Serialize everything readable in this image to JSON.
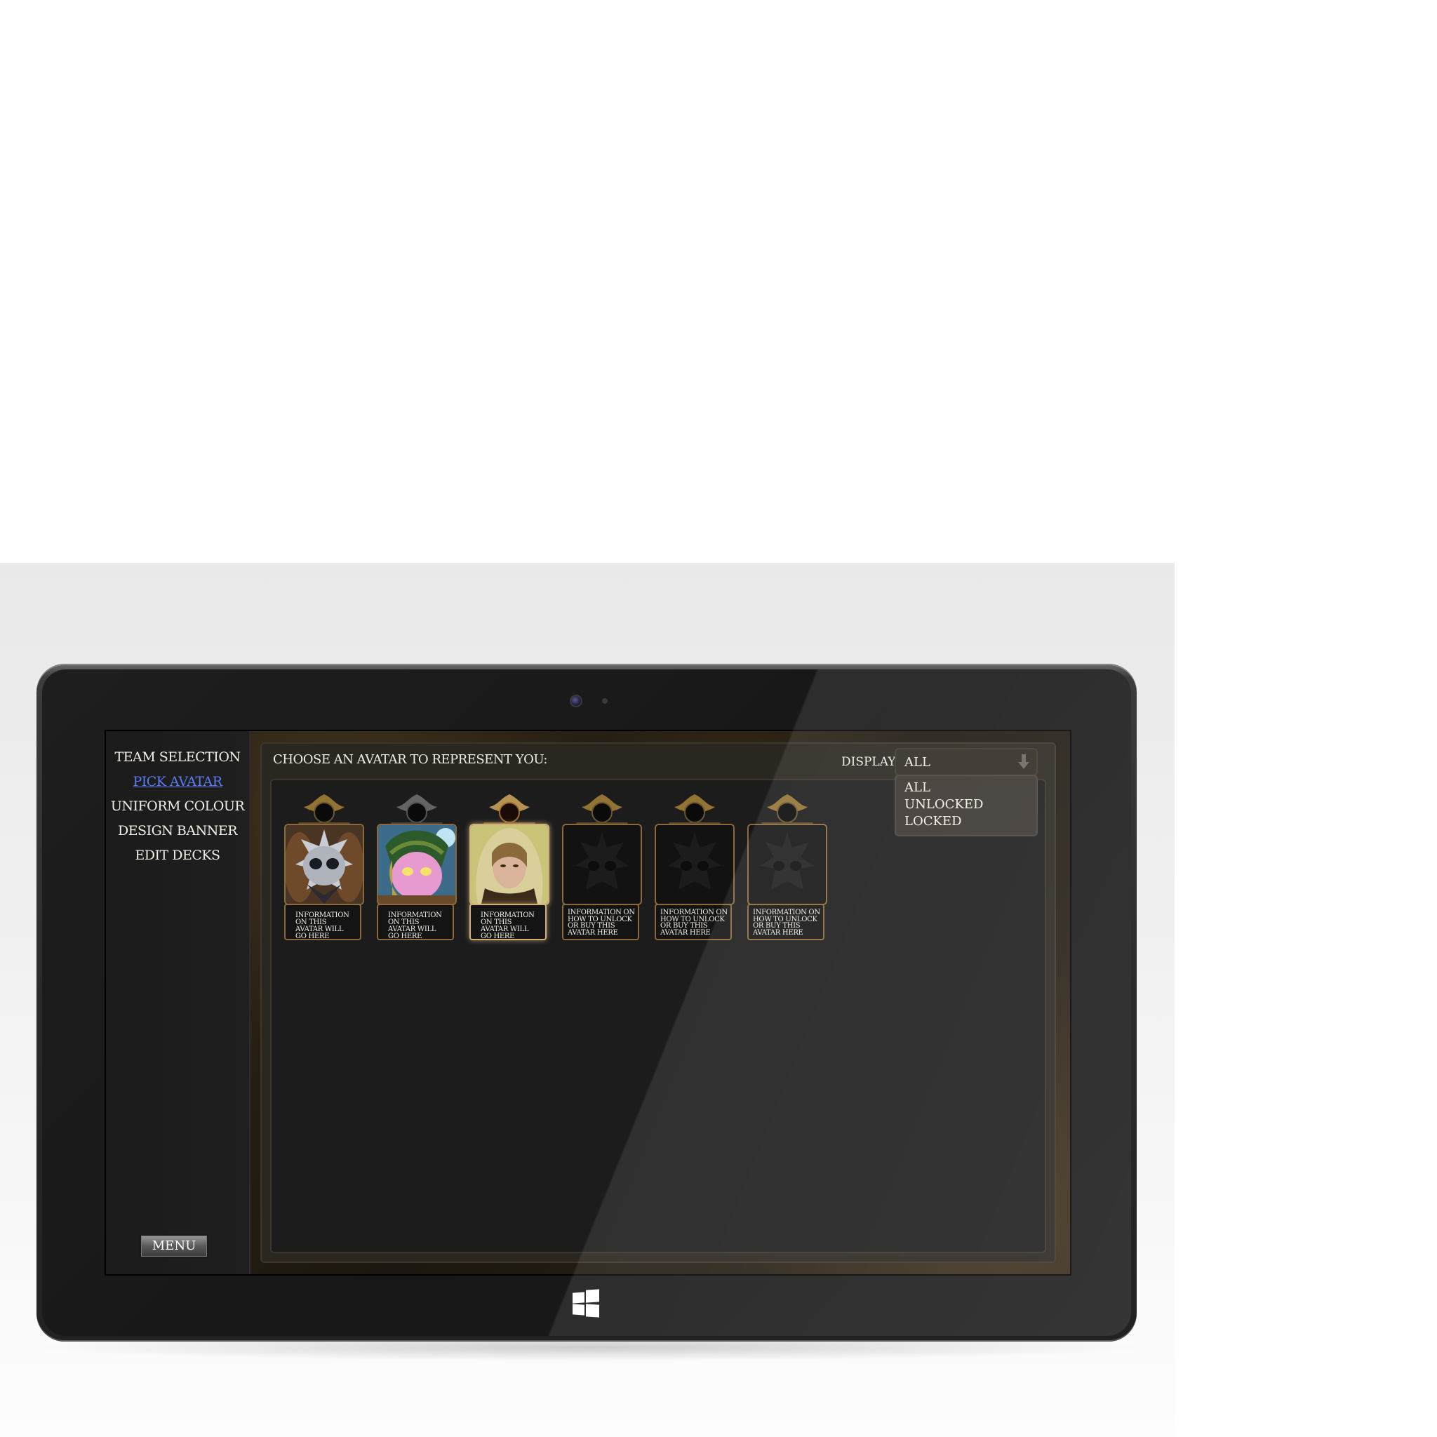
{
  "sidebar": {
    "items": [
      {
        "label": "TEAM SELECTION"
      },
      {
        "label": "PICK AVATAR"
      },
      {
        "label": "UNIFORM COLOUR"
      },
      {
        "label": "DESIGN BANNER"
      },
      {
        "label": "EDIT DECKS"
      }
    ],
    "menu_label": "MENU"
  },
  "header": {
    "title": "CHOOSE AN AVATAR TO REPRESENT YOU:",
    "display_label": "DISPLAY:",
    "display_value": "ALL"
  },
  "dropdown": {
    "options": [
      "ALL",
      "UNLOCKED",
      "LOCKED"
    ]
  },
  "avatars": [
    {
      "info": "INFORMATION ON THIS AVATAR WILL GO HERE",
      "state": "unlocked",
      "portrait": "armored-warrior-portrait"
    },
    {
      "info": "INFORMATION ON THIS AVATAR WILL GO HERE",
      "state": "unlocked",
      "portrait": "forest-creature-portrait"
    },
    {
      "info": "INFORMATION ON THIS AVATAR WILL GO HERE",
      "state": "unlocked",
      "portrait": "hooded-woman-portrait",
      "selected": true
    },
    {
      "info": "INFORMATION ON HOW TO UNLOCK OR BUY THIS AVATAR HERE",
      "state": "locked",
      "portrait": "locked-silhouette"
    },
    {
      "info": "INFORMATION ON HOW TO UNLOCK OR BUY THIS AVATAR HERE",
      "state": "locked",
      "portrait": "locked-silhouette"
    },
    {
      "info": "INFORMATION ON HOW TO UNLOCK OR BUY THIS AVATAR HERE",
      "state": "locked",
      "portrait": "locked-silhouette"
    }
  ],
  "colors": {
    "active_nav": "#5b7cf0",
    "text": "#f2efe6",
    "frame_gold": "#8a6a3a"
  },
  "icons": {
    "camera": "camera-icon",
    "windows": "windows-logo-icon",
    "dropdown_arrow": "arrow-down-icon"
  }
}
